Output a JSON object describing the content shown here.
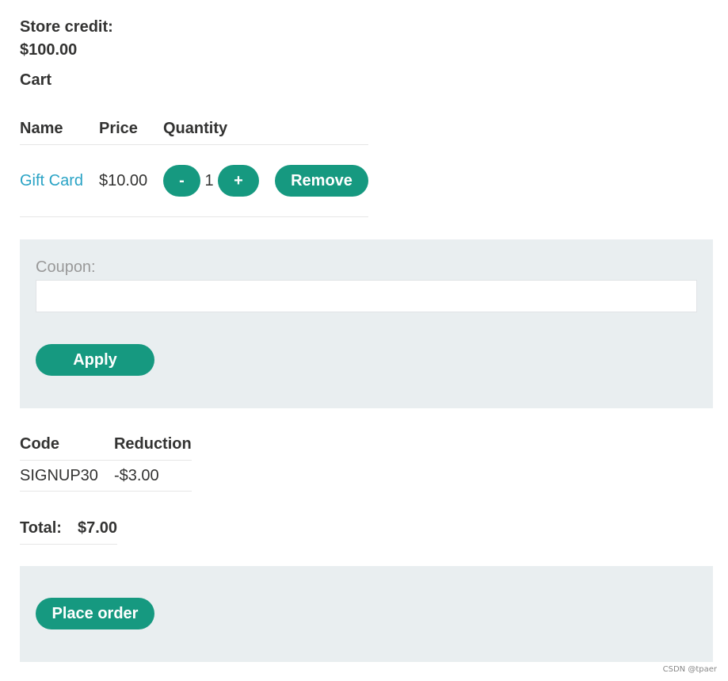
{
  "store_credit": {
    "label": "Store credit:",
    "value": "$100.00"
  },
  "cart": {
    "heading": "Cart",
    "columns": [
      "Name",
      "Price",
      "Quantity"
    ],
    "items": [
      {
        "name": "Gift Card",
        "price": "$10.00",
        "minus": "-",
        "quantity": "1",
        "plus": "+",
        "remove": "Remove"
      }
    ]
  },
  "coupon": {
    "label": "Coupon:",
    "value": "",
    "apply": "Apply"
  },
  "codes": {
    "columns": [
      "Code",
      "Reduction"
    ],
    "rows": [
      {
        "code": "SIGNUP30",
        "reduction": "-$3.00"
      }
    ]
  },
  "total": {
    "label": "Total:",
    "value": "$7.00"
  },
  "order": {
    "button": "Place order"
  },
  "watermark": "CSDN @tpaer",
  "colors": {
    "accent": "#169980",
    "link": "#29a3c5",
    "panel": "#e9eef0"
  }
}
